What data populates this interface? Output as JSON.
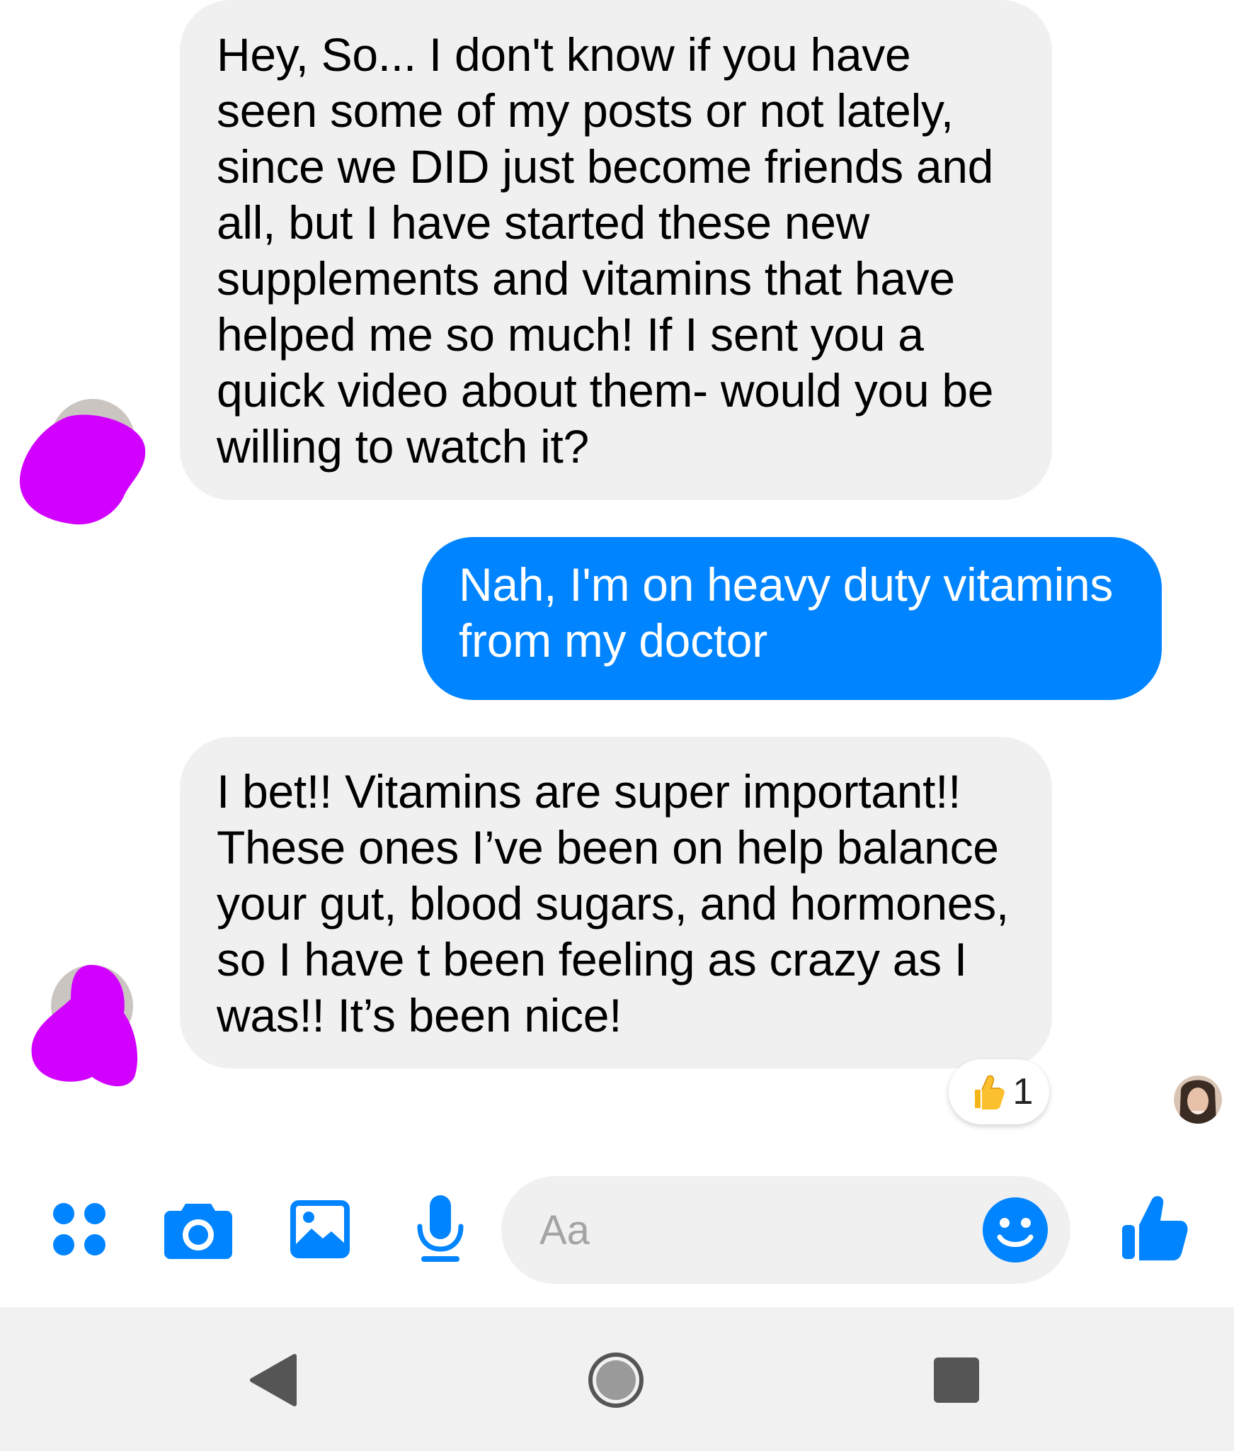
{
  "messages": [
    {
      "sender": "incoming",
      "text": "Hey, So... I don't know if you have seen some of my posts or not lately, since we DID just become friends and all, but I have started these new supplements and vitamins that have helped me so much! If I sent you a quick video about them- would you be willing to watch it?"
    },
    {
      "sender": "outgoing",
      "text": "Nah, I'm on heavy duty vitamins from my doctor"
    },
    {
      "sender": "incoming",
      "text": "I bet!! Vitamins are super important!! These ones I’ve been on help balance your gut, blood sugars, and hormones, so I have t been feeling as crazy as I was!! It’s been nice!"
    }
  ],
  "reaction": {
    "icon": "thumbs-up-emoji",
    "count": "1"
  },
  "composer": {
    "placeholder": "Aa",
    "tools": [
      "more-apps-icon",
      "camera-icon",
      "gallery-icon",
      "microphone-icon"
    ],
    "emoji_icon": "smiley-icon",
    "send_icon": "thumbs-up-icon"
  },
  "colors": {
    "accent": "#0084ff",
    "incoming_bubble": "#f1f0f0",
    "redaction": "#d100ff"
  }
}
